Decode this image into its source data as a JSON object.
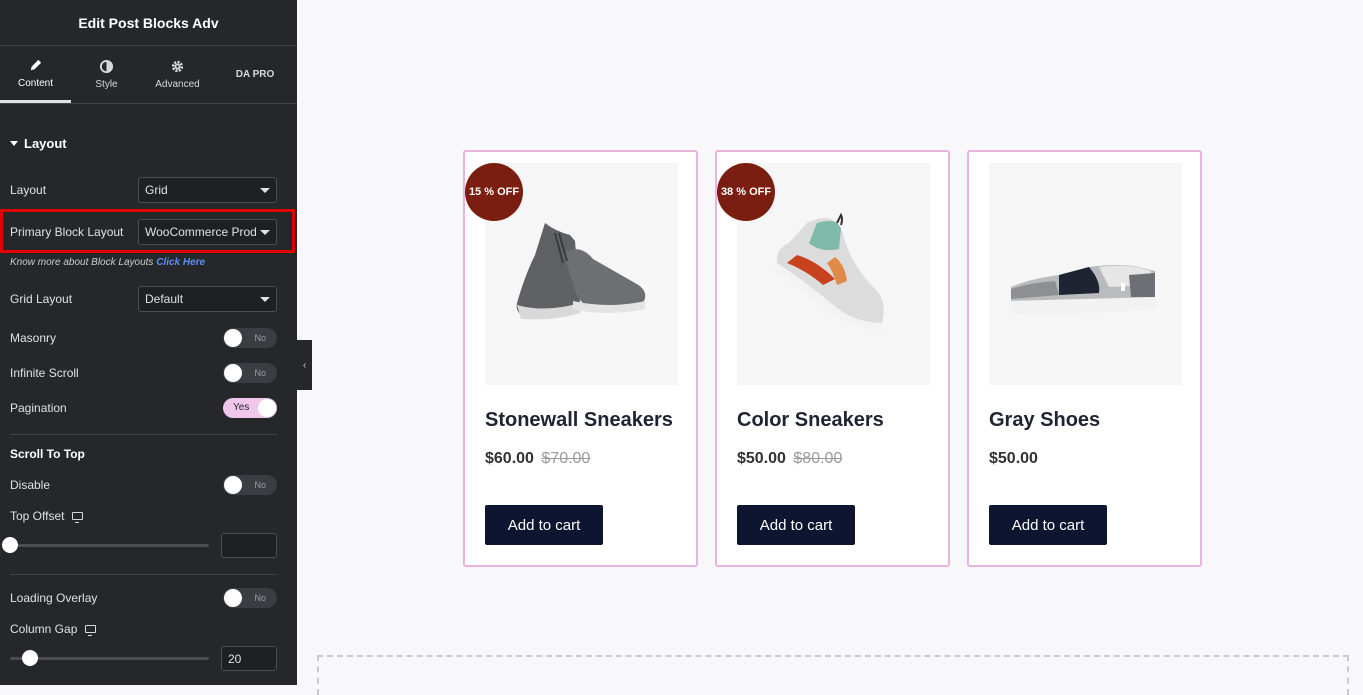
{
  "panel": {
    "title": "Edit Post Blocks Adv",
    "tabs": [
      {
        "label": "Content",
        "icon": "pencil-icon"
      },
      {
        "label": "Style",
        "icon": "half-circle-icon"
      },
      {
        "label": "Advanced",
        "icon": "gear-icon"
      },
      {
        "label": "DA PRO",
        "icon": ""
      }
    ],
    "section_title": "Layout",
    "layout_label": "Layout",
    "layout_value": "Grid",
    "primary_block_label": "Primary Block Layout",
    "primary_block_value": "WooCommerce Prod",
    "info_text": "Know more about Block Layouts",
    "info_link": "Click Here",
    "grid_layout_label": "Grid Layout",
    "grid_layout_value": "Default",
    "masonry_label": "Masonry",
    "masonry_value": "No",
    "infinite_scroll_label": "Infinite Scroll",
    "infinite_scroll_value": "No",
    "pagination_label": "Pagination",
    "pagination_value": "Yes",
    "scroll_to_top_title": "Scroll To Top",
    "disable_label": "Disable",
    "disable_value": "No",
    "top_offset_label": "Top Offset",
    "top_offset_value": "",
    "loading_overlay_label": "Loading Overlay",
    "loading_overlay_value": "No",
    "column_gap_label": "Column Gap",
    "column_gap_value": "20"
  },
  "products": [
    {
      "name": "Stonewall Sneakers",
      "price": "$60.00",
      "old_price": "$70.00",
      "badge": "15 % OFF",
      "button": "Add to cart",
      "image": "gray-sneaker-image"
    },
    {
      "name": "Color Sneakers",
      "price": "$50.00",
      "old_price": "$80.00",
      "badge": "38 % OFF",
      "button": "Add to cart",
      "image": "color-sneaker-image"
    },
    {
      "name": "Gray Shoes",
      "price": "$50.00",
      "old_price": "",
      "badge": "",
      "button": "Add to cart",
      "image": "gray-shoe-image"
    }
  ],
  "colors": {
    "panel_bg": "#26272b",
    "highlight": "#e00000",
    "badge": "#7b1e12",
    "button": "#0e1530",
    "card_border": "#eab3dc",
    "toggle_on": "#f0c6ea"
  }
}
